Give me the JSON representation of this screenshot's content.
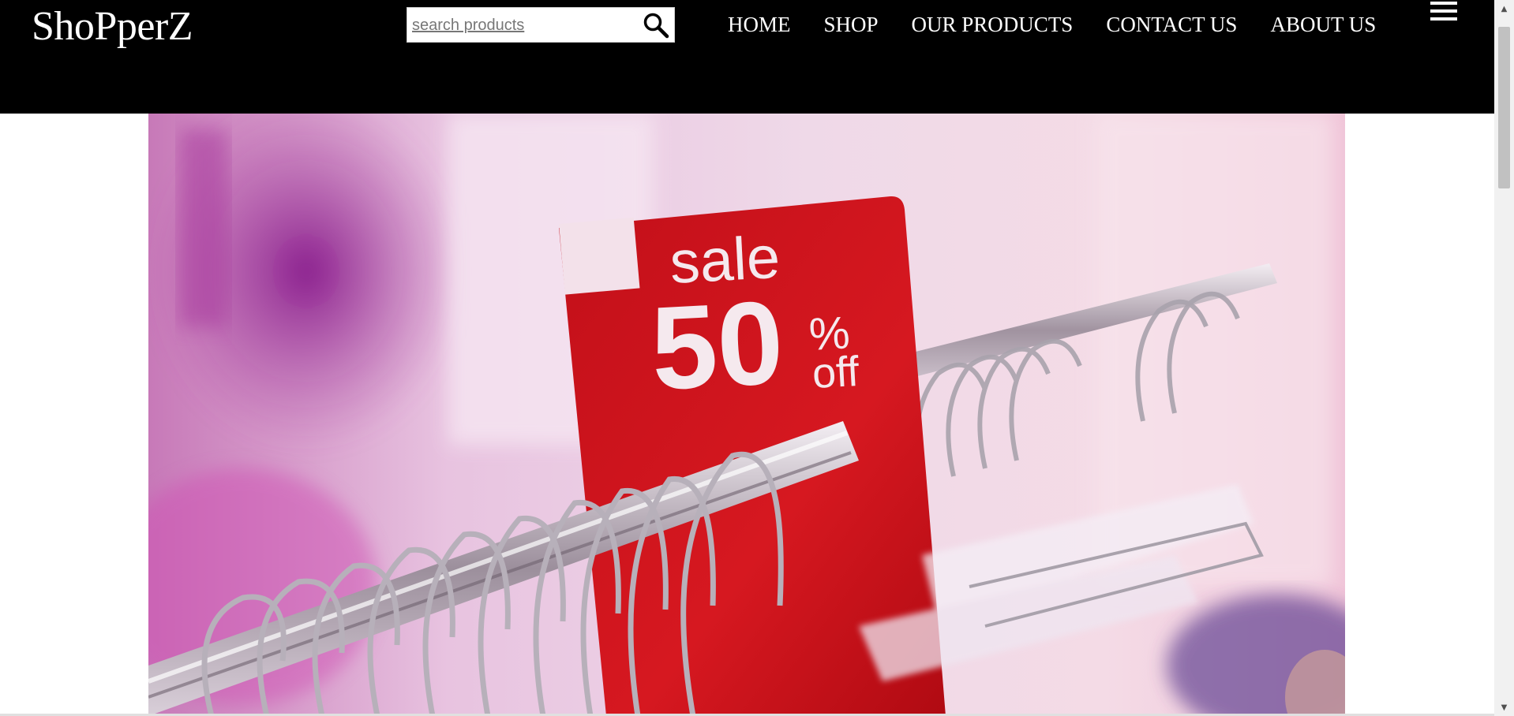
{
  "brand": {
    "name": "ShoPperZ"
  },
  "search": {
    "placeholder": "search products",
    "icon": "search-icon"
  },
  "nav": {
    "items": [
      {
        "label": "HOME"
      },
      {
        "label": "SHOP"
      },
      {
        "label": "OUR PRODUCTS"
      },
      {
        "label": "CONTACT US"
      },
      {
        "label": "ABOUT US"
      }
    ],
    "menu_icon": "hamburger-menu-icon"
  },
  "hero": {
    "sign": {
      "line1": "sale",
      "line2": "50",
      "line3": "%",
      "line4": "off"
    }
  },
  "colors": {
    "header_bg": "#000000",
    "header_text": "#ffffff",
    "sale_red": "#d0101a"
  }
}
